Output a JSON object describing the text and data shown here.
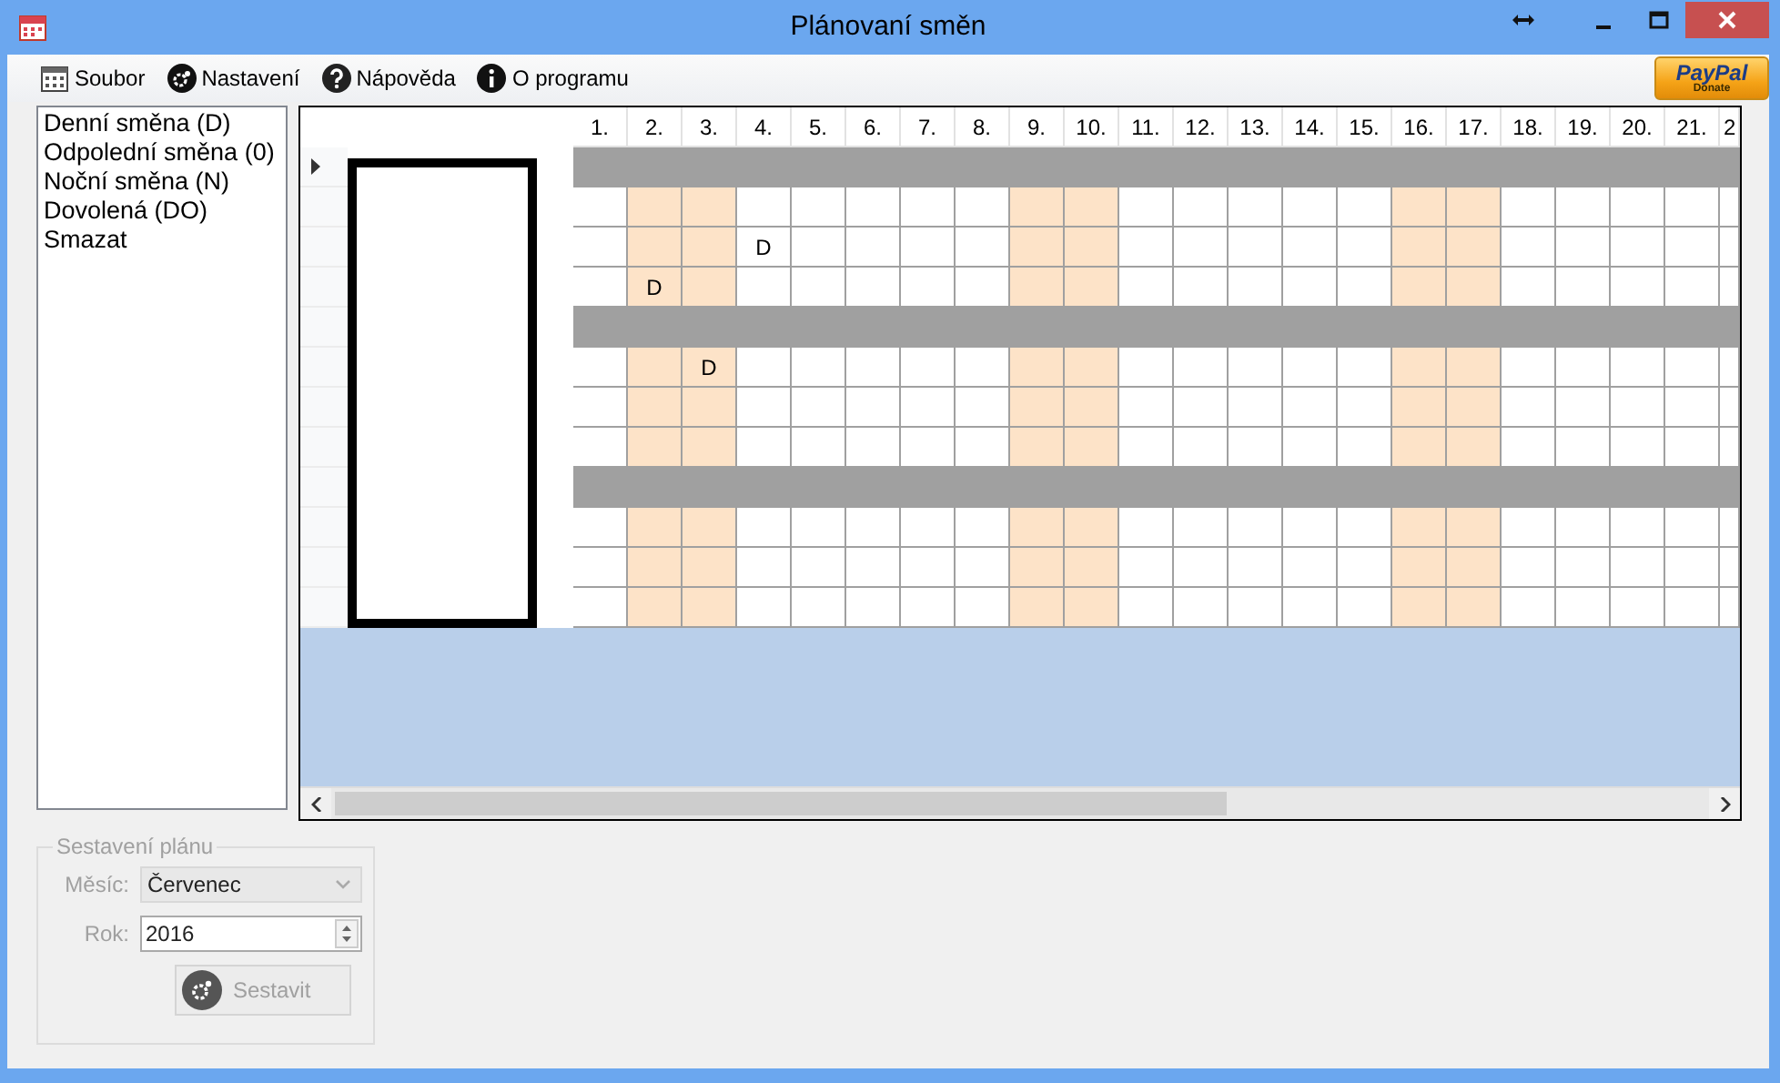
{
  "window": {
    "title": "Plánovaní směn"
  },
  "menu": [
    {
      "label": "Soubor"
    },
    {
      "label": "Nastavení"
    },
    {
      "label": "Nápověda"
    },
    {
      "label": "O programu"
    }
  ],
  "paypal_button": {
    "brand": "PayPal",
    "caption": "Donate"
  },
  "shifts": [
    "Denní směna (D)",
    "Odpolední směna (0)",
    "Noční směna (N)",
    "Dovolená (DO)",
    "Smazat"
  ],
  "grid": {
    "columns": [
      {
        "label": "1.",
        "weekend": false
      },
      {
        "label": "2.",
        "weekend": true
      },
      {
        "label": "3.",
        "weekend": true
      },
      {
        "label": "4.",
        "weekend": false
      },
      {
        "label": "5.",
        "weekend": false
      },
      {
        "label": "6.",
        "weekend": false
      },
      {
        "label": "7.",
        "weekend": false
      },
      {
        "label": "8.",
        "weekend": false
      },
      {
        "label": "9.",
        "weekend": true
      },
      {
        "label": "10.",
        "weekend": true
      },
      {
        "label": "11.",
        "weekend": false
      },
      {
        "label": "12.",
        "weekend": false
      },
      {
        "label": "13.",
        "weekend": false
      },
      {
        "label": "14.",
        "weekend": false
      },
      {
        "label": "15.",
        "weekend": false
      },
      {
        "label": "16.",
        "weekend": true
      },
      {
        "label": "17.",
        "weekend": true
      },
      {
        "label": "18.",
        "weekend": false
      },
      {
        "label": "19.",
        "weekend": false
      },
      {
        "label": "20.",
        "weekend": false
      },
      {
        "label": "21.",
        "weekend": false
      },
      {
        "label": "2",
        "weekend": false
      }
    ],
    "rows": [
      {
        "kind": "separator",
        "current": true
      },
      {
        "kind": "person",
        "current": false
      },
      {
        "kind": "person",
        "current": false,
        "cells": [
          null,
          null,
          null,
          "D",
          null,
          null,
          null,
          null,
          null,
          null,
          null,
          null,
          null,
          null,
          null,
          null,
          null,
          null,
          null,
          null,
          null,
          null
        ]
      },
      {
        "kind": "person",
        "current": false,
        "cells": [
          null,
          "D",
          null,
          null,
          null,
          null,
          null,
          null,
          null,
          null,
          null,
          null,
          null,
          null,
          null,
          null,
          null,
          null,
          null,
          null,
          null,
          null
        ]
      },
      {
        "kind": "separator",
        "current": false
      },
      {
        "kind": "person",
        "current": false,
        "cells": [
          null,
          null,
          "D",
          null,
          null,
          null,
          null,
          null,
          null,
          null,
          null,
          null,
          null,
          null,
          null,
          null,
          null,
          null,
          null,
          null,
          null,
          null
        ]
      },
      {
        "kind": "person",
        "current": false
      },
      {
        "kind": "person",
        "current": false
      },
      {
        "kind": "separator",
        "current": false
      },
      {
        "kind": "person",
        "current": false
      },
      {
        "kind": "person",
        "current": false
      },
      {
        "kind": "person",
        "current": false
      }
    ]
  },
  "plan_form": {
    "legend": "Sestavení plánu",
    "disabled": true,
    "month_label": "Měsíc:",
    "month": "Červenec",
    "year_label": "Rok:",
    "year": "2016",
    "build_button": "Sestavit"
  }
}
